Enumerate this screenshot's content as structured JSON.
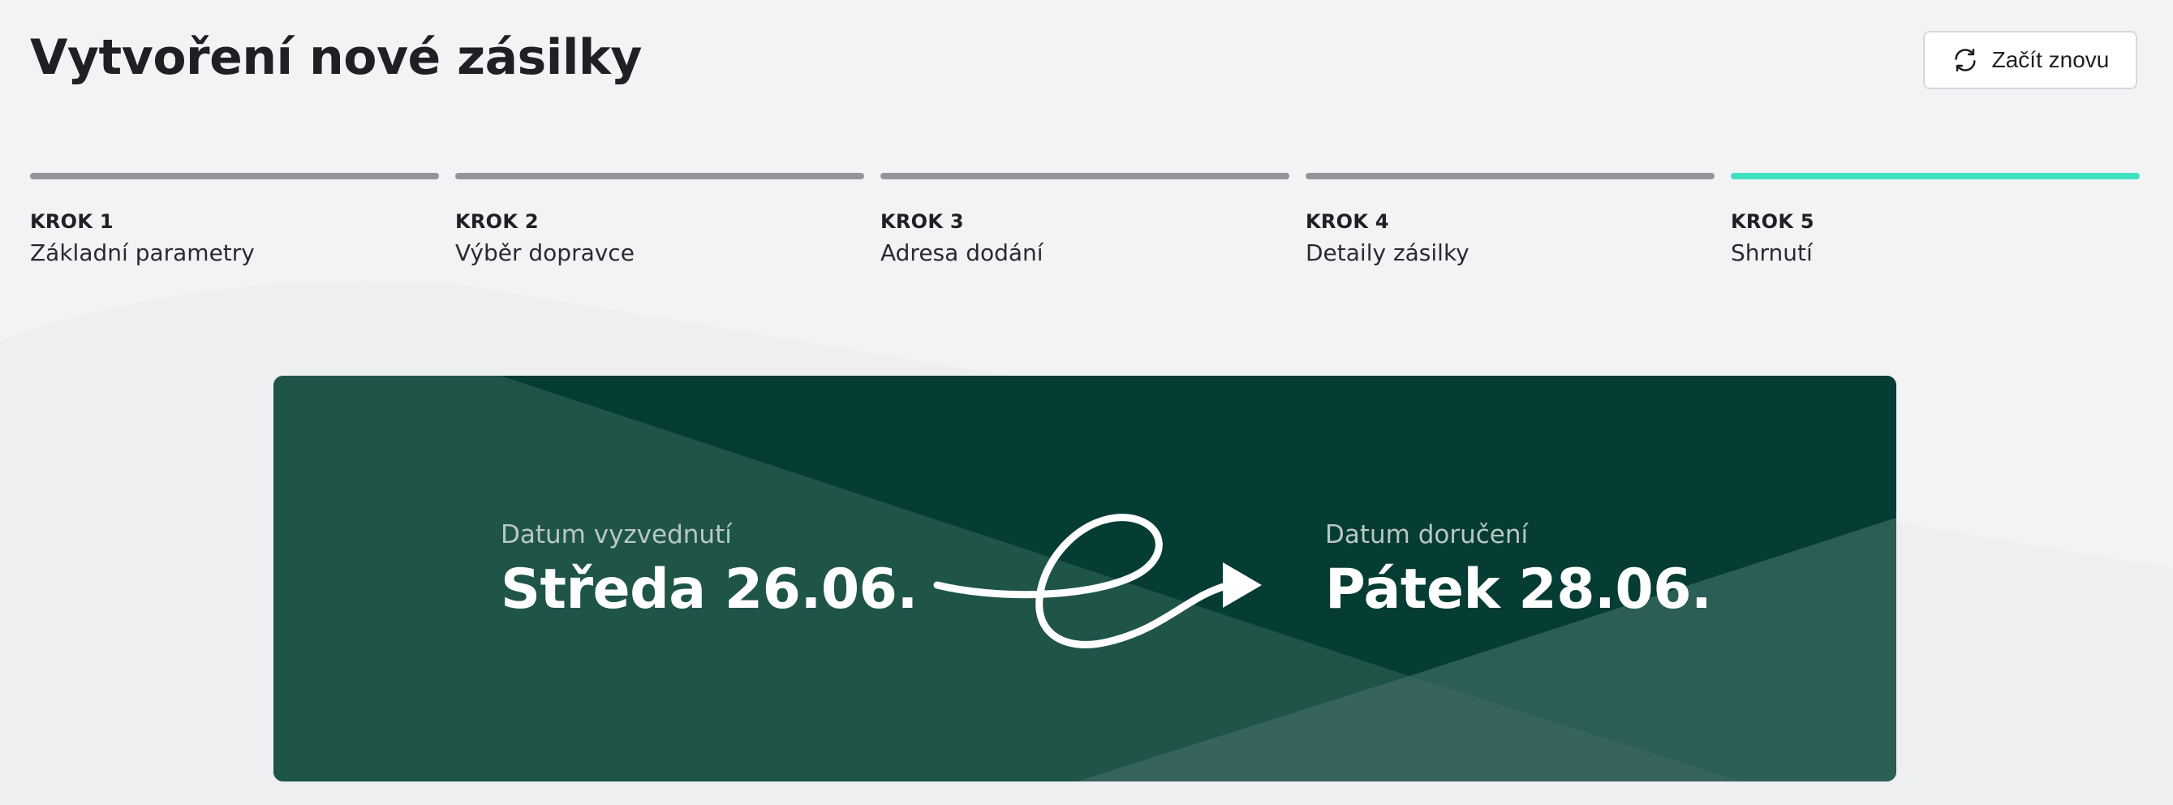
{
  "header": {
    "title": "Vytvoření nové zásilky",
    "restart_label": "Začít znovu",
    "restart_icon": "refresh-icon"
  },
  "steps": [
    {
      "kicker": "KROK 1",
      "name": "Základní parametry",
      "active": false
    },
    {
      "kicker": "KROK 2",
      "name": "Výběr dopravce",
      "active": false
    },
    {
      "kicker": "KROK 3",
      "name": "Adresa dodání",
      "active": false
    },
    {
      "kicker": "KROK 4",
      "name": "Detaily zásilky",
      "active": false
    },
    {
      "kicker": "KROK 5",
      "name": "Shrnutí",
      "active": true
    }
  ],
  "summary": {
    "pickup_label": "Datum vyzvednutí",
    "pickup_value": "Středa 26.06.",
    "delivery_label": "Datum doručení",
    "delivery_value": "Pátek 28.06.",
    "route_icon": "looped-arrow-icon"
  },
  "colors": {
    "background": "#f2f3f5",
    "step_inactive": "#94959b",
    "step_active": "#3fe0c2",
    "card_dark": "#053c33",
    "card_mid": "#1f5449"
  }
}
